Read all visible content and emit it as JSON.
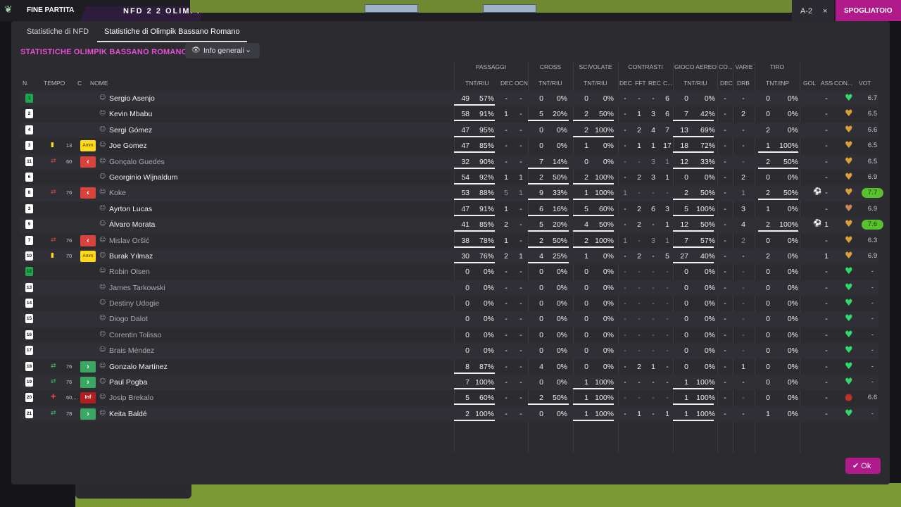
{
  "topbar": {
    "title": "FINE PARTITA",
    "home": "NFD",
    "score": "2 2",
    "away": "OLIMPI",
    "mini1": "A-2",
    "mini2": "×",
    "action": "SPOGLIATOIO"
  },
  "tabs": [
    {
      "label": "Statistiche di NFD",
      "active": false
    },
    {
      "label": "Statistiche di Olimpik Bassano Romano",
      "active": true
    }
  ],
  "section_title": "STATISTICHE OLIMPIK BASSANO ROMANO",
  "view_dropdown": {
    "label": "Info generali",
    "icon": "eye-icon"
  },
  "groups": {
    "passaggi": "PASSAGGI",
    "cross": "CROSS",
    "scivolate": "SCIVOLATE",
    "contrasti": "CONTRASTI",
    "gioco_aereo": "GIOCO AEREO",
    "co": "CO...",
    "varie": "VARIE",
    "tiro": "TIRO"
  },
  "headers": {
    "n": "N.",
    "tempo": "TEMPO",
    "c": "C",
    "nome": "NOME",
    "pass_tr": "TNT/RIU",
    "pass_dec": "DEC",
    "pass_ocn": "OCN",
    "cross_tr": "TNT/RIU",
    "sciv_tr": "TNT/RIU",
    "con_dec": "DEC",
    "con_fft": "FFT",
    "con_rec": "REC",
    "con_c": "C...",
    "aer_tr": "TNT/RIU",
    "co_dec": "DEC",
    "drb": "DRB",
    "tiro_tr": "TNT/INP",
    "gol": "GOL",
    "ass": "ASS",
    "con": "CON...",
    "vot": "VOT"
  },
  "players": [
    {
      "num": "1",
      "gk": true,
      "icon": "",
      "min": "",
      "badge": "",
      "name": "Sergio Asenjo",
      "dim": false,
      "p": [
        "49",
        "57%",
        "-",
        "-"
      ],
      "cr": [
        "0",
        "0%"
      ],
      "sc": [
        "0",
        "0%"
      ],
      "ct": [
        "-",
        "-",
        "-",
        "6"
      ],
      "ae": [
        "0",
        "0%"
      ],
      "cd": "-",
      "drb": "-",
      "ti": [
        "0",
        "0%"
      ],
      "gol": "",
      "ass": "-",
      "con": "green",
      "vot": "6.7",
      "hi": false
    },
    {
      "num": "2",
      "gk": false,
      "icon": "",
      "min": "",
      "badge": "",
      "name": "Kevin Mbabu",
      "dim": false,
      "p": [
        "58",
        "91%",
        "1",
        "-"
      ],
      "cr": [
        "5",
        "20%"
      ],
      "sc": [
        "2",
        "50%"
      ],
      "ct": [
        "-",
        "1",
        "3",
        "6"
      ],
      "ae": [
        "7",
        "42%"
      ],
      "cd": "-",
      "drb": "2",
      "ti": [
        "0",
        "0%"
      ],
      "gol": "",
      "ass": "-",
      "con": "gold",
      "vot": "6.5",
      "hi": false
    },
    {
      "num": "4",
      "gk": false,
      "icon": "",
      "min": "",
      "badge": "",
      "name": "Sergi Gómez",
      "dim": false,
      "p": [
        "47",
        "95%",
        "-",
        "-"
      ],
      "cr": [
        "0",
        "0%"
      ],
      "sc": [
        "2",
        "100%"
      ],
      "ct": [
        "-",
        "2",
        "4",
        "7"
      ],
      "ae": [
        "13",
        "69%"
      ],
      "cd": "-",
      "drb": "-",
      "ti": [
        "2",
        "0%"
      ],
      "gol": "",
      "ass": "-",
      "con": "gold",
      "vot": "6.6",
      "hi": false
    },
    {
      "num": "3",
      "gk": false,
      "icon": "yellow",
      "min": "13",
      "badge": "Amm",
      "name": "Joe Gomez",
      "dim": false,
      "p": [
        "47",
        "85%",
        "-",
        "-"
      ],
      "cr": [
        "0",
        "0%"
      ],
      "sc": [
        "1",
        "0%"
      ],
      "ct": [
        "-",
        "1",
        "1",
        "17"
      ],
      "ae": [
        "18",
        "72%"
      ],
      "cd": "-",
      "drb": "-",
      "ti": [
        "1",
        "100%"
      ],
      "gol": "",
      "ass": "-",
      "con": "gold",
      "vot": "6.5",
      "hi": false
    },
    {
      "num": "11",
      "gk": false,
      "icon": "out",
      "min": "60",
      "badge": "out",
      "name": "Gonçalo Guedes",
      "dim": true,
      "p": [
        "32",
        "90%",
        "-",
        "-"
      ],
      "cr": [
        "7",
        "14%"
      ],
      "sc": [
        "0",
        "0%"
      ],
      "ct": [
        "-",
        "-",
        "3",
        "1"
      ],
      "ae": [
        "12",
        "33%"
      ],
      "cd": "-",
      "drb": "-",
      "ti": [
        "2",
        "50%"
      ],
      "gol": "",
      "ass": "-",
      "con": "gold",
      "vot": "6.5",
      "hi": false
    },
    {
      "num": "6",
      "gk": false,
      "icon": "",
      "min": "",
      "badge": "",
      "name": "Georginio Wijnaldum",
      "dim": false,
      "p": [
        "54",
        "92%",
        "1",
        "1"
      ],
      "cr": [
        "2",
        "50%"
      ],
      "sc": [
        "2",
        "100%"
      ],
      "ct": [
        "-",
        "2",
        "3",
        "1"
      ],
      "ae": [
        "0",
        "0%"
      ],
      "cd": "-",
      "drb": "2",
      "ti": [
        "0",
        "0%"
      ],
      "gol": "",
      "ass": "-",
      "con": "gold",
      "vot": "6.9",
      "hi": false
    },
    {
      "num": "8",
      "gk": false,
      "icon": "out",
      "min": "76",
      "badge": "out",
      "name": "Koke",
      "dim": true,
      "p": [
        "53",
        "88%",
        "5",
        "1"
      ],
      "cr": [
        "9",
        "33%"
      ],
      "sc": [
        "1",
        "100%"
      ],
      "ct": [
        "1",
        "-",
        "-",
        "-"
      ],
      "ae": [
        "2",
        "50%"
      ],
      "cd": "-",
      "drb": "1",
      "ti": [
        "2",
        "50%"
      ],
      "gol": "ball",
      "ass": "-",
      "con": "gold",
      "vot": "7.7",
      "hi": true
    },
    {
      "num": "3",
      "gk": false,
      "icon": "",
      "min": "",
      "badge": "",
      "name": "Ayrton Lucas",
      "dim": false,
      "p": [
        "47",
        "91%",
        "1",
        "-"
      ],
      "cr": [
        "6",
        "16%"
      ],
      "sc": [
        "5",
        "60%"
      ],
      "ct": [
        "-",
        "2",
        "6",
        "3"
      ],
      "ae": [
        "5",
        "100%"
      ],
      "cd": "-",
      "drb": "3",
      "ti": [
        "1",
        "0%"
      ],
      "gol": "",
      "ass": "-",
      "con": "bronze",
      "vot": "6.9",
      "hi": false
    },
    {
      "num": "9",
      "gk": false,
      "icon": "",
      "min": "",
      "badge": "",
      "name": "Álvaro Morata",
      "dim": false,
      "p": [
        "41",
        "85%",
        "2",
        "-"
      ],
      "cr": [
        "5",
        "20%"
      ],
      "sc": [
        "4",
        "50%"
      ],
      "ct": [
        "-",
        "2",
        "-",
        "1"
      ],
      "ae": [
        "12",
        "50%"
      ],
      "cd": "-",
      "drb": "4",
      "ti": [
        "2",
        "100%"
      ],
      "gol": "ball",
      "ass": "1",
      "con": "gold",
      "vot": "7.6",
      "hi": true
    },
    {
      "num": "7",
      "gk": false,
      "icon": "out",
      "min": "76",
      "badge": "out",
      "name": "Mislav Oršić",
      "dim": true,
      "p": [
        "38",
        "78%",
        "1",
        "-"
      ],
      "cr": [
        "2",
        "50%"
      ],
      "sc": [
        "2",
        "100%"
      ],
      "ct": [
        "1",
        "-",
        "3",
        "1"
      ],
      "ae": [
        "7",
        "57%"
      ],
      "cd": "-",
      "drb": "2",
      "ti": [
        "0",
        "0%"
      ],
      "gol": "",
      "ass": "-",
      "con": "gold",
      "vot": "6.3",
      "hi": false
    },
    {
      "num": "10",
      "gk": false,
      "icon": "yellow",
      "min": "70",
      "badge": "Amm",
      "name": "Burak Yılmaz",
      "dim": false,
      "p": [
        "30",
        "76%",
        "2",
        "1"
      ],
      "cr": [
        "4",
        "25%"
      ],
      "sc": [
        "1",
        "0%"
      ],
      "ct": [
        "-",
        "2",
        "-",
        "5"
      ],
      "ae": [
        "27",
        "40%"
      ],
      "cd": "-",
      "drb": "-",
      "ti": [
        "2",
        "0%"
      ],
      "gol": "",
      "ass": "1",
      "con": "gold",
      "vot": "6.9",
      "hi": false
    },
    {
      "num": "12",
      "gk": true,
      "icon": "",
      "min": "",
      "badge": "",
      "name": "Robin Olsen",
      "dim": true,
      "p": [
        "0",
        "0%",
        "-",
        "-"
      ],
      "cr": [
        "0",
        "0%"
      ],
      "sc": [
        "0",
        "0%"
      ],
      "ct": [
        "-",
        "-",
        "-",
        "-"
      ],
      "ae": [
        "0",
        "0%"
      ],
      "cd": "-",
      "drb": "-",
      "ti": [
        "0",
        "0%"
      ],
      "gol": "",
      "ass": "-",
      "con": "green",
      "vot": "-",
      "hi": false
    },
    {
      "num": "13",
      "gk": false,
      "icon": "",
      "min": "",
      "badge": "",
      "name": "James Tarkowski",
      "dim": true,
      "p": [
        "0",
        "0%",
        "-",
        "-"
      ],
      "cr": [
        "0",
        "0%"
      ],
      "sc": [
        "0",
        "0%"
      ],
      "ct": [
        "-",
        "-",
        "-",
        "-"
      ],
      "ae": [
        "0",
        "0%"
      ],
      "cd": "-",
      "drb": "-",
      "ti": [
        "0",
        "0%"
      ],
      "gol": "",
      "ass": "-",
      "con": "green",
      "vot": "-",
      "hi": false
    },
    {
      "num": "14",
      "gk": false,
      "icon": "",
      "min": "",
      "badge": "",
      "name": "Destiny Udogie",
      "dim": true,
      "p": [
        "0",
        "0%",
        "-",
        "-"
      ],
      "cr": [
        "0",
        "0%"
      ],
      "sc": [
        "0",
        "0%"
      ],
      "ct": [
        "-",
        "-",
        "-",
        "-"
      ],
      "ae": [
        "0",
        "0%"
      ],
      "cd": "-",
      "drb": "-",
      "ti": [
        "0",
        "0%"
      ],
      "gol": "",
      "ass": "-",
      "con": "green",
      "vot": "-",
      "hi": false
    },
    {
      "num": "15",
      "gk": false,
      "icon": "",
      "min": "",
      "badge": "",
      "name": "Diogo Dalot",
      "dim": true,
      "p": [
        "0",
        "0%",
        "-",
        "-"
      ],
      "cr": [
        "0",
        "0%"
      ],
      "sc": [
        "0",
        "0%"
      ],
      "ct": [
        "-",
        "-",
        "-",
        "-"
      ],
      "ae": [
        "0",
        "0%"
      ],
      "cd": "-",
      "drb": "-",
      "ti": [
        "0",
        "0%"
      ],
      "gol": "",
      "ass": "-",
      "con": "green",
      "vot": "-",
      "hi": false
    },
    {
      "num": "16",
      "gk": false,
      "icon": "",
      "min": "",
      "badge": "",
      "name": "Corentin Tolisso",
      "dim": true,
      "p": [
        "0",
        "0%",
        "-",
        "-"
      ],
      "cr": [
        "0",
        "0%"
      ],
      "sc": [
        "0",
        "0%"
      ],
      "ct": [
        "-",
        "-",
        "-",
        "-"
      ],
      "ae": [
        "0",
        "0%"
      ],
      "cd": "-",
      "drb": "-",
      "ti": [
        "0",
        "0%"
      ],
      "gol": "",
      "ass": "-",
      "con": "green",
      "vot": "-",
      "hi": false
    },
    {
      "num": "17",
      "gk": false,
      "icon": "",
      "min": "",
      "badge": "",
      "name": "Brais Méndez",
      "dim": true,
      "p": [
        "0",
        "0%",
        "-",
        "-"
      ],
      "cr": [
        "0",
        "0%"
      ],
      "sc": [
        "0",
        "0%"
      ],
      "ct": [
        "-",
        "-",
        "-",
        "-"
      ],
      "ae": [
        "0",
        "0%"
      ],
      "cd": "-",
      "drb": "-",
      "ti": [
        "0",
        "0%"
      ],
      "gol": "",
      "ass": "-",
      "con": "green",
      "vot": "-",
      "hi": false
    },
    {
      "num": "18",
      "gk": false,
      "icon": "in",
      "min": "76",
      "badge": "in",
      "name": "Gonzalo Martínez",
      "dim": false,
      "p": [
        "8",
        "87%",
        "-",
        "-"
      ],
      "cr": [
        "4",
        "0%"
      ],
      "sc": [
        "0",
        "0%"
      ],
      "ct": [
        "-",
        "2",
        "1",
        "-"
      ],
      "ae": [
        "0",
        "0%"
      ],
      "cd": "-",
      "drb": "1",
      "ti": [
        "0",
        "0%"
      ],
      "gol": "",
      "ass": "-",
      "con": "green",
      "vot": "-",
      "hi": false
    },
    {
      "num": "19",
      "gk": false,
      "icon": "in",
      "min": "76",
      "badge": "in",
      "name": "Paul Pogba",
      "dim": false,
      "p": [
        "7",
        "100%",
        "-",
        "-"
      ],
      "cr": [
        "0",
        "0%"
      ],
      "sc": [
        "1",
        "100%"
      ],
      "ct": [
        "-",
        "-",
        "-",
        "-"
      ],
      "ae": [
        "1",
        "100%"
      ],
      "cd": "-",
      "drb": "-",
      "ti": [
        "0",
        "0%"
      ],
      "gol": "",
      "ass": "-",
      "con": "green",
      "vot": "-",
      "hi": false
    },
    {
      "num": "20",
      "gk": false,
      "icon": "inj",
      "min": "60,...",
      "badge": "Inf",
      "name": "Josip Brekalo",
      "dim": true,
      "p": [
        "5",
        "60%",
        "-",
        "-"
      ],
      "cr": [
        "2",
        "50%"
      ],
      "sc": [
        "1",
        "100%"
      ],
      "ct": [
        "-",
        "-",
        "-",
        "-"
      ],
      "ae": [
        "1",
        "100%"
      ],
      "cd": "-",
      "drb": "-",
      "ti": [
        "0",
        "0%"
      ],
      "gol": "",
      "ass": "-",
      "con": "red",
      "vot": "6.6",
      "hi": false
    },
    {
      "num": "21",
      "gk": false,
      "icon": "in",
      "min": "78",
      "badge": "in",
      "name": "Keita Baldé",
      "dim": false,
      "p": [
        "2",
        "100%",
        "-",
        "-"
      ],
      "cr": [
        "0",
        "0%"
      ],
      "sc": [
        "1",
        "100%"
      ],
      "ct": [
        "-",
        "1",
        "-",
        "1"
      ],
      "ae": [
        "1",
        "100%"
      ],
      "cd": "-",
      "drb": "-",
      "ti": [
        "1",
        "0%"
      ],
      "gol": "",
      "ass": "-",
      "con": "green",
      "vot": "-",
      "hi": false
    }
  ],
  "ok_button": "Ok",
  "colors": {
    "accent": "#e64fd6",
    "button": "#b01a8a",
    "vote_high": "#58c22e",
    "morale_green": "#2edb6a",
    "morale_gold": "#d9a03a",
    "morale_bronze": "#c9865a",
    "morale_red": "#c0302a"
  }
}
